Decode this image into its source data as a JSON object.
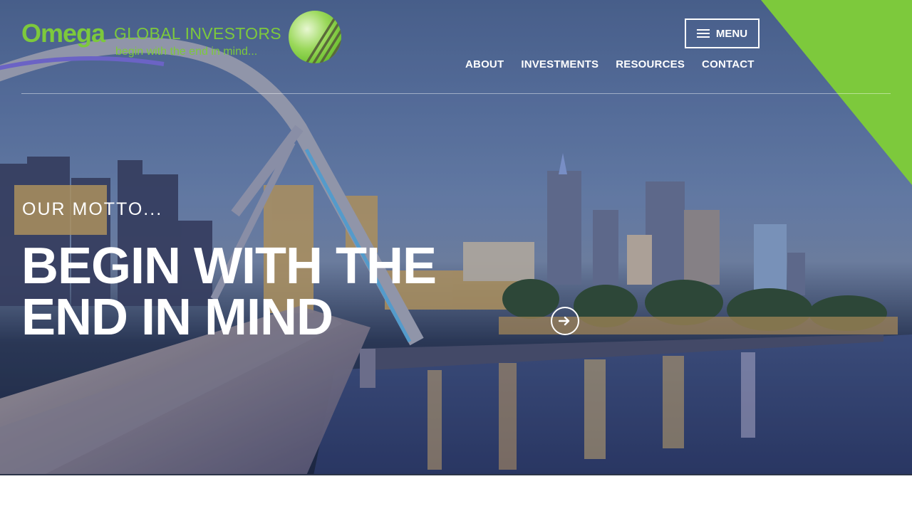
{
  "brand": {
    "name": "Omega",
    "sub": "GLOBAL INVESTORS",
    "tagline": "begin with the end in mind...",
    "accent_color": "#7dc93c"
  },
  "header": {
    "menu_label": "MENU",
    "menu_icon": "hamburger-icon",
    "nav": [
      {
        "label": "ABOUT"
      },
      {
        "label": "INVESTMENTS"
      },
      {
        "label": "RESOURCES"
      },
      {
        "label": "CONTACT"
      }
    ]
  },
  "hero": {
    "eyebrow": "OUR MOTTO...",
    "headline_line1": "BEGIN WITH THE",
    "headline_line2": "END IN MIND",
    "next_icon": "arrow-right-icon",
    "background_image": "city-skyline-river-bridge-photo"
  }
}
